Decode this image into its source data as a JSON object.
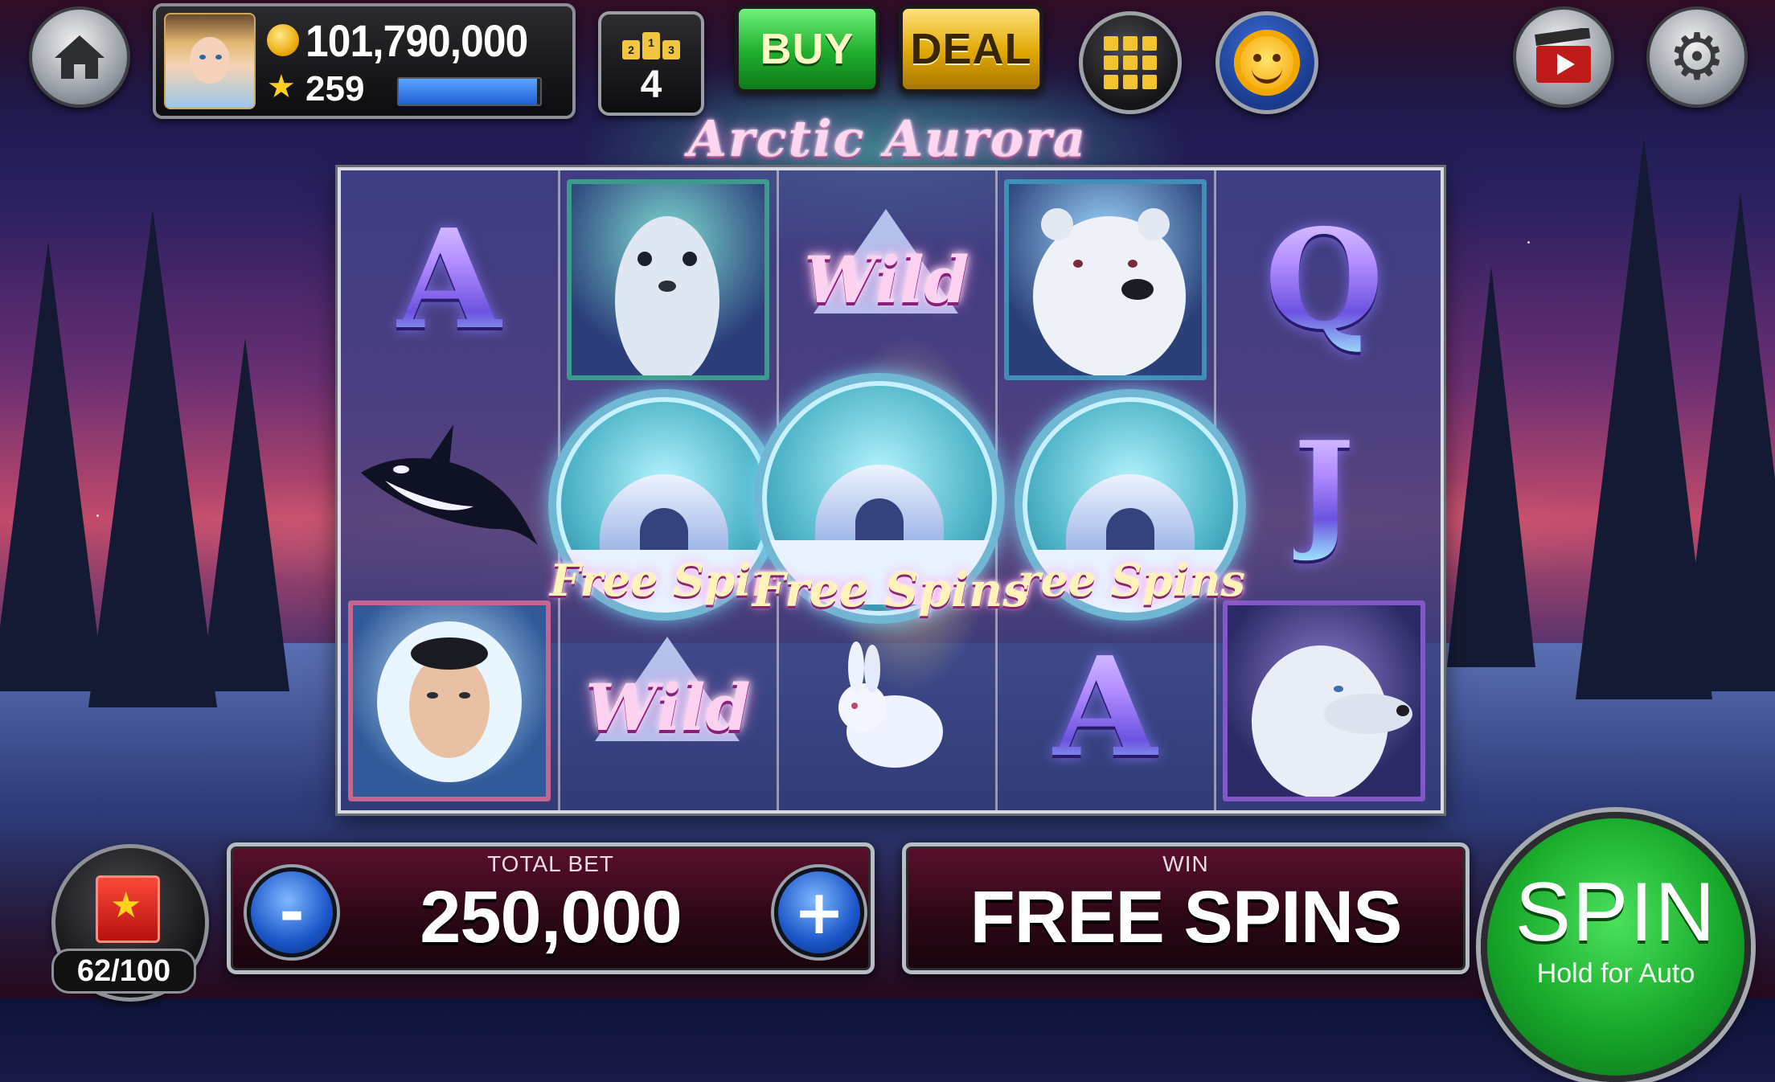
{
  "colors": {
    "buy_button": "#1fae2c",
    "deal_button": "#e0a600",
    "spin_button": "#17a82a",
    "xp_bar": "#1f5fd4",
    "title_glow": "#ff8cdc"
  },
  "header": {
    "coins": "101,790,000",
    "level": "259",
    "xp_progress": 0.98,
    "leaderboard_rank": "4",
    "podium_places": [
      "2",
      "1",
      "3"
    ],
    "buy_label": "BUY",
    "deal_label": "DEAL"
  },
  "icons": {
    "home": "home-icon",
    "coin": "coin-icon",
    "star": "star-icon",
    "leaderboard": "podium-icon",
    "games_grid": "grid-icon",
    "bonus": "sun-face-icon",
    "video": "clapperboard-video-icon",
    "settings": "gear-icon",
    "gift": "gift-box-icon"
  },
  "game": {
    "title": "Arctic Aurora"
  },
  "reels": [
    [
      "A",
      "orca",
      "inuit-woman"
    ],
    [
      "seal",
      "Free Spins",
      "Wild"
    ],
    [
      "Wild",
      "Free Spins",
      "rabbit"
    ],
    [
      "polar-bear",
      "Free Spins",
      "A"
    ],
    [
      "Q",
      "J",
      "wolf"
    ]
  ],
  "symbols": {
    "wild_text": "Wild",
    "scatter_text_left": "Free Spir",
    "scatter_text_center": "Free Spins",
    "scatter_text_right": "ree Spins"
  },
  "footer": {
    "gift_progress": "62/100",
    "total_bet_label": "TOTAL BET",
    "total_bet_value": "250,000",
    "minus_label": "-",
    "plus_label": "+",
    "win_label": "WIN",
    "win_value": "FREE SPINS",
    "spin_label": "SPIN",
    "spin_sublabel": "Hold for Auto"
  }
}
